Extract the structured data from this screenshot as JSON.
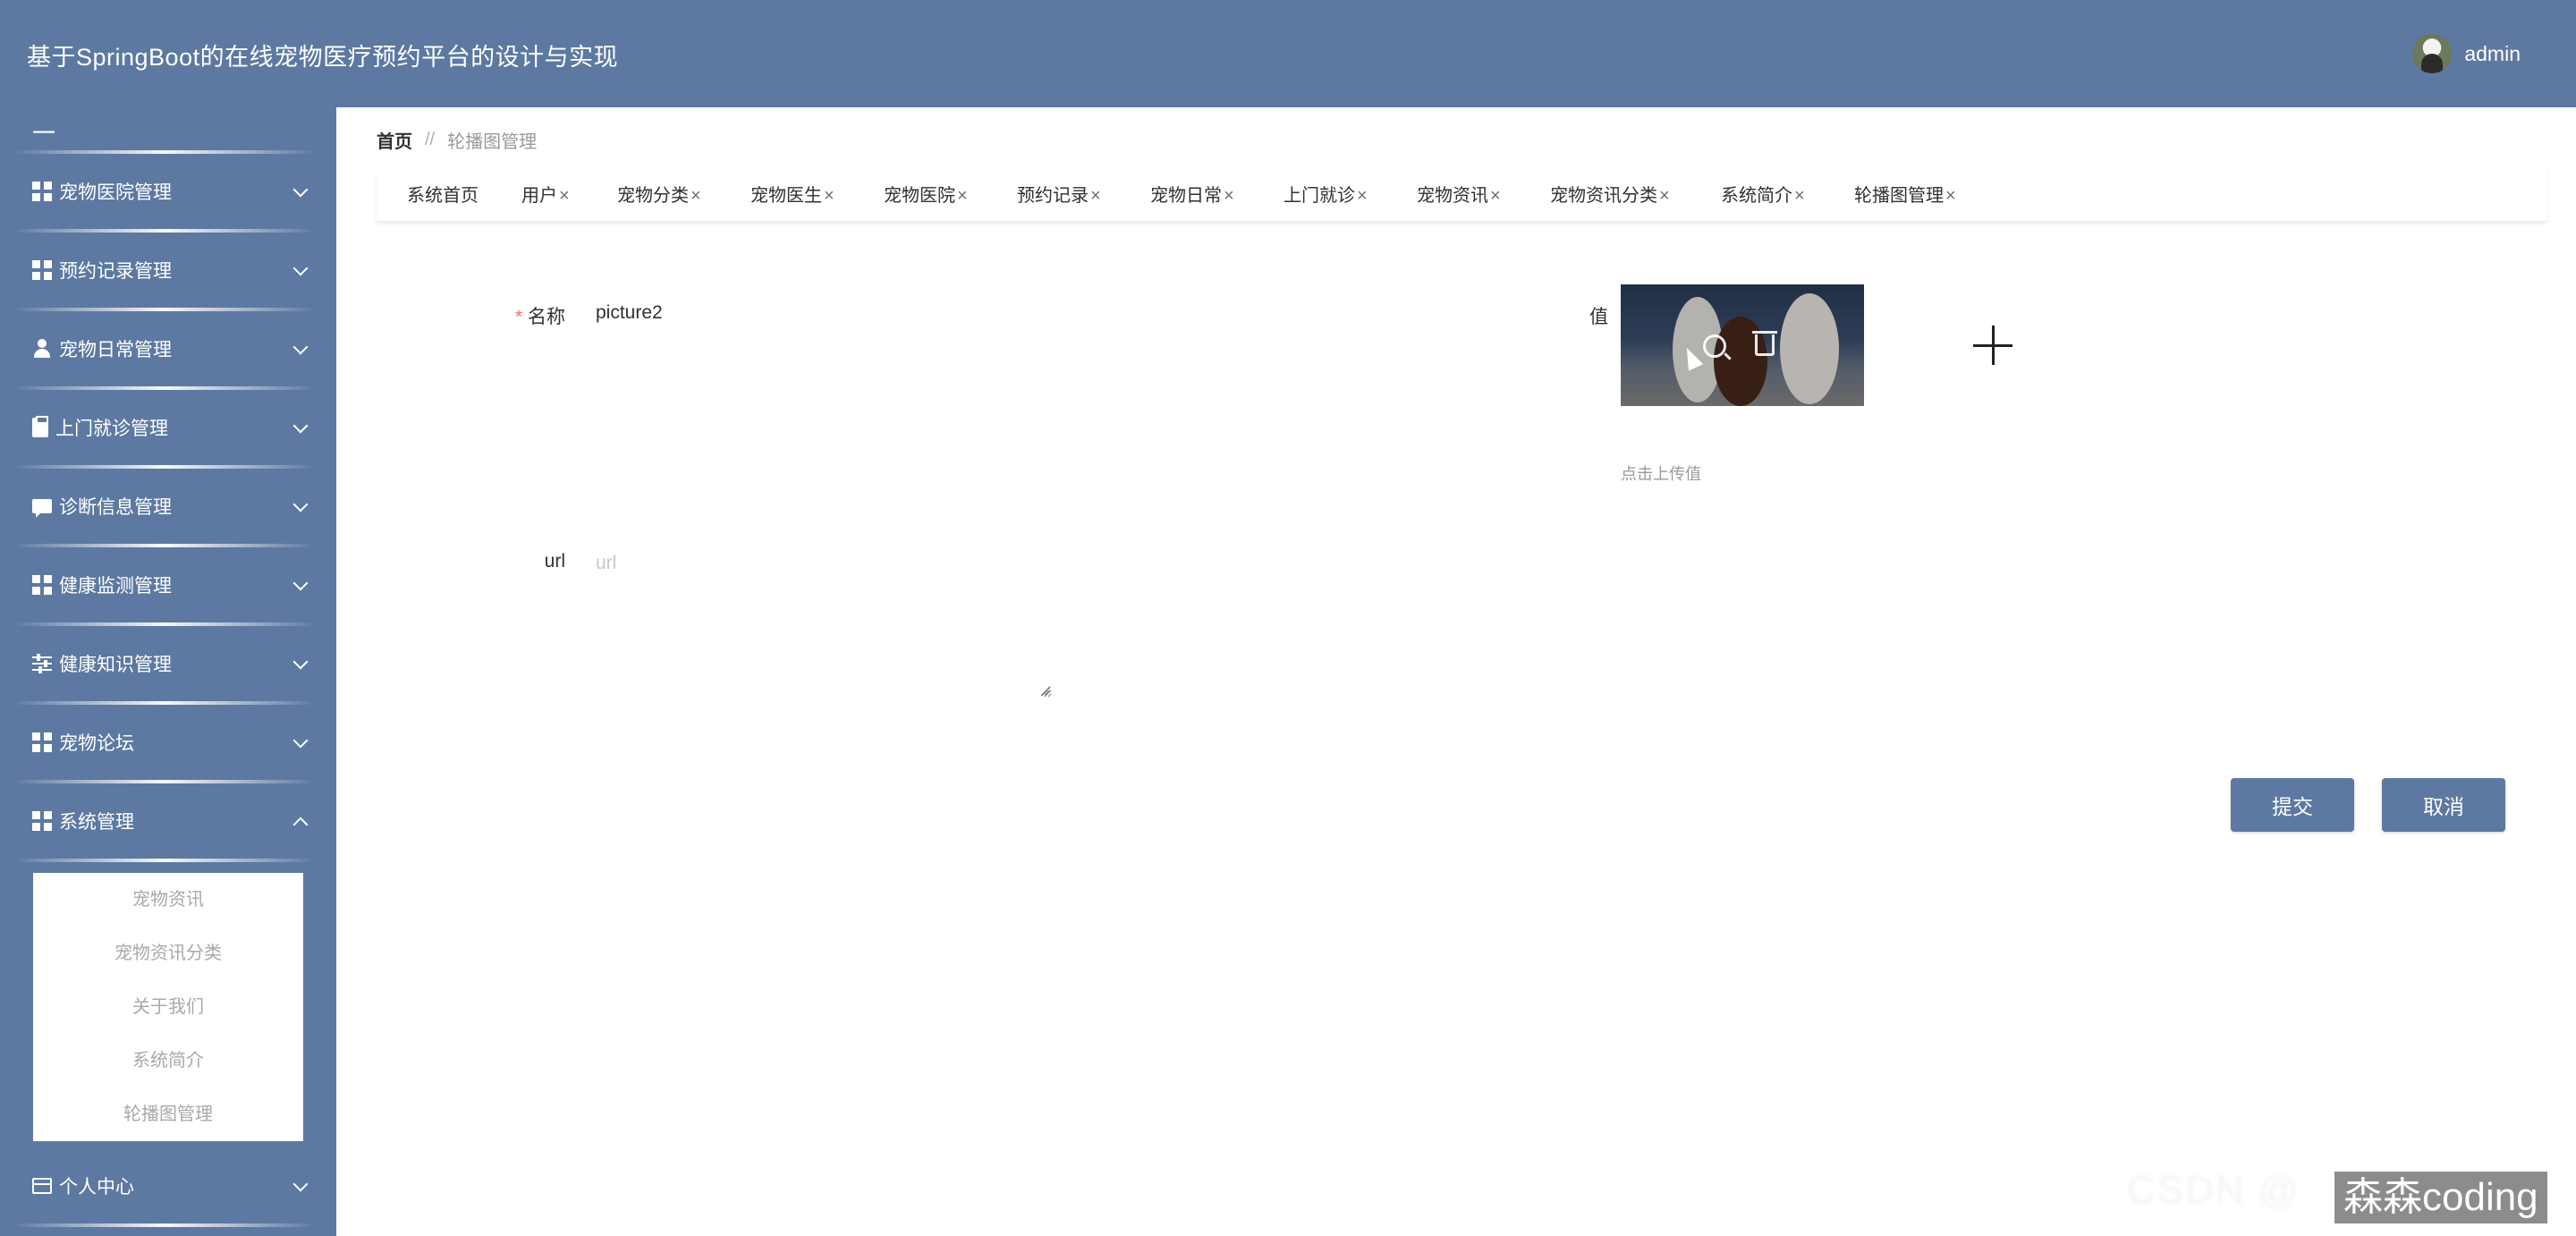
{
  "header": {
    "title": "基于SpringBoot的在线宠物医疗预约平台的设计与实现",
    "username": "admin"
  },
  "sidebar": {
    "toggle": "一",
    "items": [
      {
        "label": "宠物医院管理",
        "icon": "grid-icon"
      },
      {
        "label": "预约记录管理",
        "icon": "grid-icon"
      },
      {
        "label": "宠物日常管理",
        "icon": "user-icon"
      },
      {
        "label": "上门就诊管理",
        "icon": "clipboard-icon"
      },
      {
        "label": "诊断信息管理",
        "icon": "chat-icon"
      },
      {
        "label": "健康监测管理",
        "icon": "grid-icon"
      },
      {
        "label": "健康知识管理",
        "icon": "sliders-icon"
      },
      {
        "label": "宠物论坛",
        "icon": "grid-icon"
      },
      {
        "label": "系统管理",
        "icon": "grid-icon",
        "expanded": true
      },
      {
        "label": "个人中心",
        "icon": "card-icon"
      }
    ],
    "submenu": [
      "宠物资讯",
      "宠物资讯分类",
      "关于我们",
      "系统简介",
      "轮播图管理"
    ]
  },
  "breadcrumb": {
    "home": "首页",
    "separator": "//",
    "current": "轮播图管理"
  },
  "tabs": [
    {
      "label": "系统首页",
      "closable": false
    },
    {
      "label": "用户",
      "closable": true
    },
    {
      "label": "宠物分类",
      "closable": true
    },
    {
      "label": "宠物医生",
      "closable": true
    },
    {
      "label": "宠物医院",
      "closable": true
    },
    {
      "label": "预约记录",
      "closable": true
    },
    {
      "label": "宠物日常",
      "closable": true
    },
    {
      "label": "上门就诊",
      "closable": true
    },
    {
      "label": "宠物资讯",
      "closable": true
    },
    {
      "label": "宠物资讯分类",
      "closable": true
    },
    {
      "label": "系统简介",
      "closable": true
    },
    {
      "label": "轮播图管理",
      "closable": true
    }
  ],
  "tab_close_glyph": "×",
  "form": {
    "name_label": "名称",
    "name_required_mark": "*",
    "name_value": "picture2",
    "value_label": "值",
    "upload_tip": "点击上传值",
    "url_label": "url",
    "url_placeholder": "url",
    "url_value": ""
  },
  "buttons": {
    "submit": "提交",
    "cancel": "取消"
  },
  "watermark": {
    "faint": "CSDN @",
    "text": "森森coding"
  },
  "colors": {
    "primary": "#5d79a2",
    "required": "#f56c6c",
    "muted_text": "#9a9a9a"
  }
}
